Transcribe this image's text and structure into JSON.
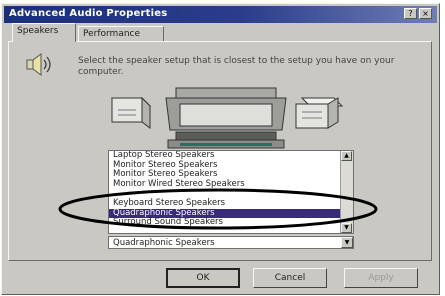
{
  "window": {
    "title": "Advanced Audio Properties",
    "help_glyph": "?",
    "close_glyph": "×"
  },
  "tabs": [
    {
      "label": "Speakers",
      "active": true
    },
    {
      "label": "Performance",
      "active": false
    }
  ],
  "speakers": {
    "instruction": "Select the speaker setup that is closest to the setup you have on your computer.",
    "icon": "speaker-volume-icon",
    "illustration": "monitor-with-two-speakers",
    "list_items": [
      {
        "label": "Laptop Stereo Speakers",
        "selected": false
      },
      {
        "label": "Monitor Stereo Speakers",
        "selected": false
      },
      {
        "label": "Monitor Stereo Speakers",
        "selected": false
      },
      {
        "label": "Monitor Wired Stereo Speakers",
        "selected": false
      },
      {
        "label": "",
        "selected": false
      },
      {
        "label": "Keyboard Stereo Speakers",
        "selected": false
      },
      {
        "label": "Quadraphonic Speakers",
        "selected": true
      },
      {
        "label": "Surround Sound Speakers",
        "selected": false
      },
      {
        "label": "",
        "selected": false
      }
    ],
    "dropdown_value": "Quadraphonic Speakers"
  },
  "buttons": {
    "ok": "OK",
    "cancel": "Cancel",
    "apply": "Apply"
  },
  "colors": {
    "titlebar": "#1a2f7c",
    "selection": "#3a2a7a",
    "face": "#c9c8c3",
    "annotation_ring": "#000000"
  }
}
